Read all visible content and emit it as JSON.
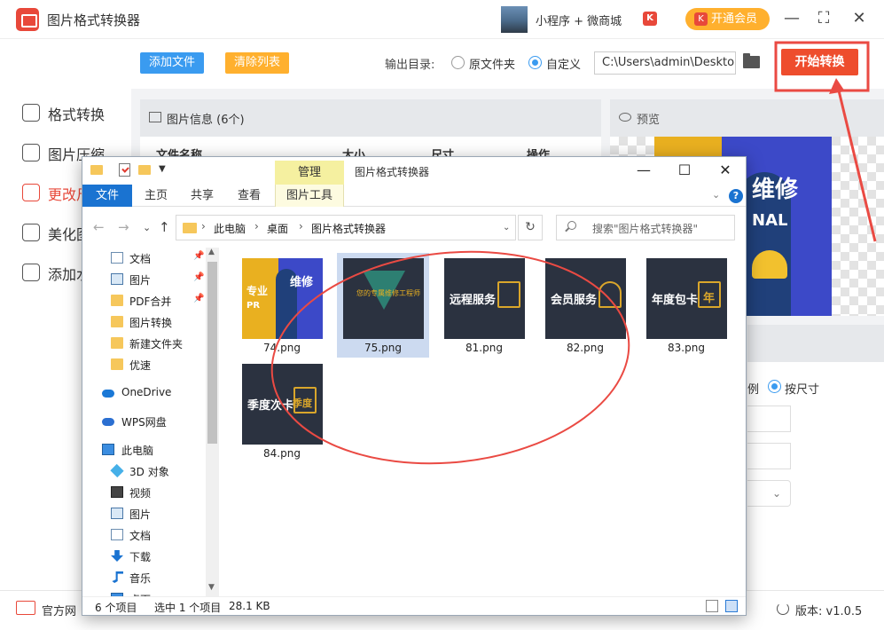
{
  "app": {
    "title": "图片格式转换器",
    "mini_program_label": "小程序 + 微商城",
    "mini_badge": "K",
    "vip_label": "开通会员",
    "vip_icon": "K",
    "minimize": "—",
    "maximize": "⛶",
    "close": "✕"
  },
  "sidebar": {
    "items": [
      {
        "label": "格式转换",
        "icon": "convert-icon"
      },
      {
        "label": "图片压缩",
        "icon": "compress-icon"
      },
      {
        "label": "更改尺",
        "icon": "resize-icon",
        "active": true
      },
      {
        "label": "美化图",
        "icon": "beautify-icon"
      },
      {
        "label": "添加水",
        "icon": "watermark-icon"
      }
    ]
  },
  "toolbar": {
    "add_files": "添加文件",
    "clear_list": "清除列表",
    "output_dir_label": "输出目录:",
    "radio_original": "原文件夹",
    "radio_custom": "自定义",
    "path_value": "C:\\Users\\admin\\Deskto",
    "start": "开始转换"
  },
  "info_panel": {
    "title": "图片信息 (6个)",
    "columns": [
      "文件名称",
      "大小",
      "尺寸",
      "操作"
    ]
  },
  "preview_panel": {
    "title": "预览",
    "overlay_text_1": "维修",
    "overlay_text_2": "NAL"
  },
  "settings": {
    "option_a": "例",
    "option_b": "按尺寸"
  },
  "statusbar": {
    "site": "官方网",
    "version": "版本: v1.0.5"
  },
  "explorer": {
    "title": "图片格式转换器",
    "context_tab": "管理",
    "ribbon": [
      "文件",
      "主页",
      "共享",
      "查看",
      "图片工具"
    ],
    "nav_back": "←",
    "nav_forward": "→",
    "nav_up": "↑",
    "breadcrumb": [
      "此电脑",
      "桌面",
      "图片格式转换器"
    ],
    "search_placeholder": "搜索\"图片格式转换器\"",
    "nav_items": [
      {
        "label": "文档",
        "icon": "document-icon",
        "pinned": true
      },
      {
        "label": "图片",
        "icon": "picture-icon",
        "pinned": true
      },
      {
        "label": "PDF合并",
        "icon": "folder-icon",
        "pinned": true
      },
      {
        "label": "图片转换",
        "icon": "folder-icon"
      },
      {
        "label": "新建文件夹",
        "icon": "folder-icon"
      },
      {
        "label": "优速",
        "icon": "folder-icon"
      },
      {
        "label": "OneDrive",
        "icon": "onedrive-icon"
      },
      {
        "label": "WPS网盘",
        "icon": "wps-cloud-icon"
      },
      {
        "label": "此电脑",
        "icon": "computer-icon"
      },
      {
        "label": "3D 对象",
        "icon": "3d-objects-icon"
      },
      {
        "label": "视频",
        "icon": "video-icon"
      },
      {
        "label": "图片",
        "icon": "picture-icon"
      },
      {
        "label": "文档",
        "icon": "document-icon"
      },
      {
        "label": "下载",
        "icon": "download-icon"
      },
      {
        "label": "音乐",
        "icon": "music-icon"
      },
      {
        "label": "桌面",
        "icon": "desktop-icon"
      }
    ],
    "files": [
      {
        "name": "74.png",
        "thumb_text": "专业",
        "thumb_text_2": "维修",
        "thumb_text_3": "PR"
      },
      {
        "name": "75.png",
        "selected": true,
        "thumb_text": "您的专属维修工程师"
      },
      {
        "name": "81.png",
        "thumb_text": "远程服务"
      },
      {
        "name": "82.png",
        "thumb_text": "会员服务"
      },
      {
        "name": "83.png",
        "thumb_text": "年度包卡",
        "badge": "年"
      },
      {
        "name": "84.png",
        "thumb_text": "季度次卡",
        "badge": "季度"
      }
    ],
    "status_count": "6 个项目",
    "status_selected": "选中 1 个项目",
    "status_size": "28.1 KB"
  },
  "annotation_color": "#ea4a43"
}
